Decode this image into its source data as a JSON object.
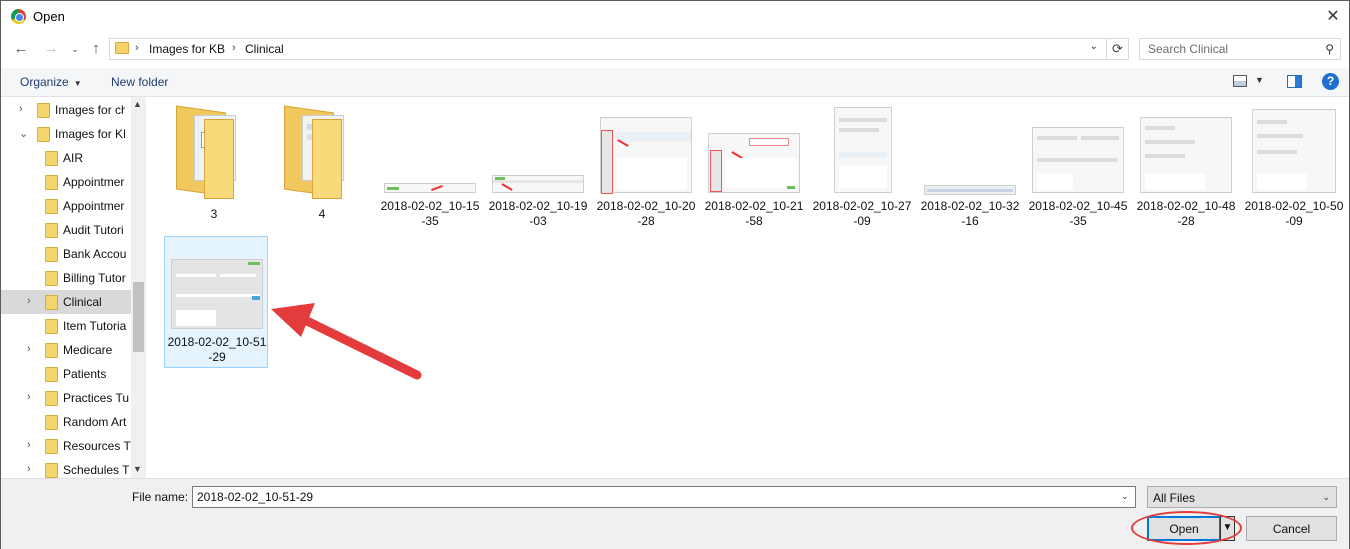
{
  "window": {
    "title": "Open"
  },
  "address_bar": {
    "crumbs": [
      "Images for KB",
      "Clinical"
    ],
    "search_placeholder": "Search Clinical"
  },
  "toolbar": {
    "organize": "Organize",
    "new_folder": "New folder",
    "help": "?"
  },
  "nav_tree": [
    {
      "label": "Images for ch",
      "expander": "›"
    },
    {
      "label": "Images for KB",
      "expander": "⌄"
    },
    {
      "label": "AIR",
      "expander": ""
    },
    {
      "label": "Appointmer",
      "expander": ""
    },
    {
      "label": "Appointmer",
      "expander": ""
    },
    {
      "label": "Audit Tutori",
      "expander": ""
    },
    {
      "label": "Bank Accou",
      "expander": ""
    },
    {
      "label": "Billing Tutor",
      "expander": ""
    },
    {
      "label": "Clinical",
      "expander": "›"
    },
    {
      "label": "Item Tutoria",
      "expander": ""
    },
    {
      "label": "Medicare",
      "expander": "›"
    },
    {
      "label": "Patients",
      "expander": ""
    },
    {
      "label": "Practices Tu",
      "expander": "›"
    },
    {
      "label": "Random Art",
      "expander": ""
    },
    {
      "label": "Resources T",
      "expander": "›"
    },
    {
      "label": "Schedules T",
      "expander": "›"
    }
  ],
  "files": [
    {
      "line1": "3",
      "line2": ""
    },
    {
      "line1": "4",
      "line2": ""
    },
    {
      "line1": "2018-02-02_10-15",
      "line2": "-35"
    },
    {
      "line1": "2018-02-02_10-19",
      "line2": "-03"
    },
    {
      "line1": "2018-02-02_10-20",
      "line2": "-28"
    },
    {
      "line1": "2018-02-02_10-21",
      "line2": "-58"
    },
    {
      "line1": "2018-02-02_10-27",
      "line2": "-09"
    },
    {
      "line1": "2018-02-02_10-32",
      "line2": "-16"
    },
    {
      "line1": "2018-02-02_10-45",
      "line2": "-35"
    },
    {
      "line1": "2018-02-02_10-48",
      "line2": "-28"
    },
    {
      "line1": "2018-02-02_10-50",
      "line2": "-09"
    },
    {
      "line1": "2018-02-02_10-51",
      "line2": "-29"
    }
  ],
  "bottom": {
    "file_name_label": "File name:",
    "file_name_value": "2018-02-02_10-51-29",
    "filter": "All Files",
    "open": "Open",
    "cancel": "Cancel"
  },
  "colors": {
    "accent": "#0078d7",
    "annotation": "#e43c3c",
    "selection": "#e5f3ff"
  }
}
